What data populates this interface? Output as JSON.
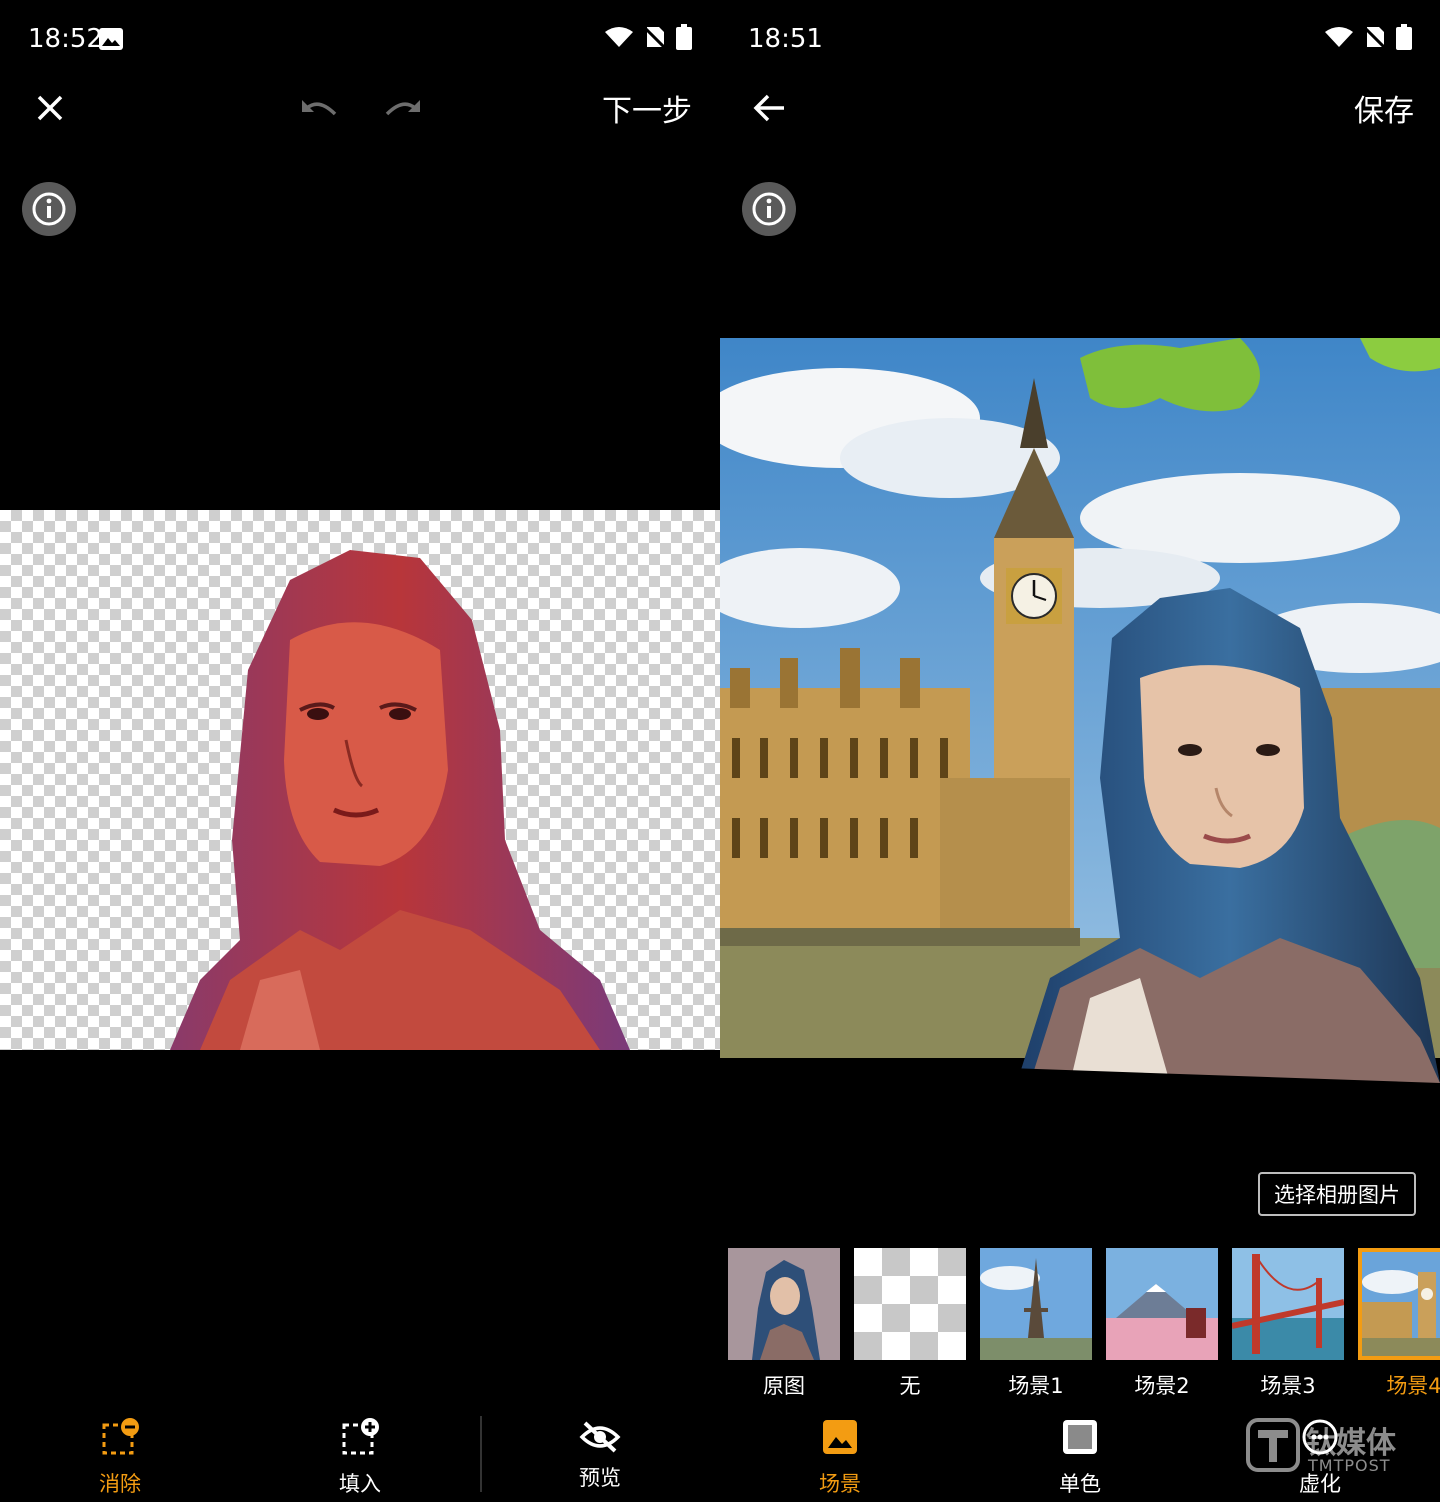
{
  "left": {
    "status": {
      "time": "18:52"
    },
    "toolbar": {
      "next_label": "下一步"
    },
    "tools": [
      {
        "label": "消除",
        "icon": "erase-selection-icon",
        "active": true
      },
      {
        "label": "填入",
        "icon": "add-selection-icon",
        "active": false
      },
      {
        "label": "预览",
        "icon": "eye-off-icon",
        "active": false
      }
    ]
  },
  "right": {
    "status": {
      "time": "18:51"
    },
    "toolbar": {
      "save_label": "保存"
    },
    "album_button": "选择相册图片",
    "scenes": [
      {
        "label": "原图",
        "selected": false
      },
      {
        "label": "无",
        "selected": false
      },
      {
        "label": "场景1",
        "selected": false
      },
      {
        "label": "场景2",
        "selected": false
      },
      {
        "label": "场景3",
        "selected": false
      },
      {
        "label": "场景4",
        "selected": true
      }
    ],
    "tools": [
      {
        "label": "场景",
        "icon": "image-icon",
        "active": true
      },
      {
        "label": "单色",
        "icon": "solid-color-icon",
        "active": false
      },
      {
        "label": "虚化",
        "icon": "blur-icon",
        "active": false
      }
    ],
    "watermark": {
      "brand": "钛媒体",
      "sub": "TMTPOST"
    }
  },
  "colors": {
    "accent": "#f39c12",
    "background": "#000000",
    "mask": "#d23a2a"
  }
}
